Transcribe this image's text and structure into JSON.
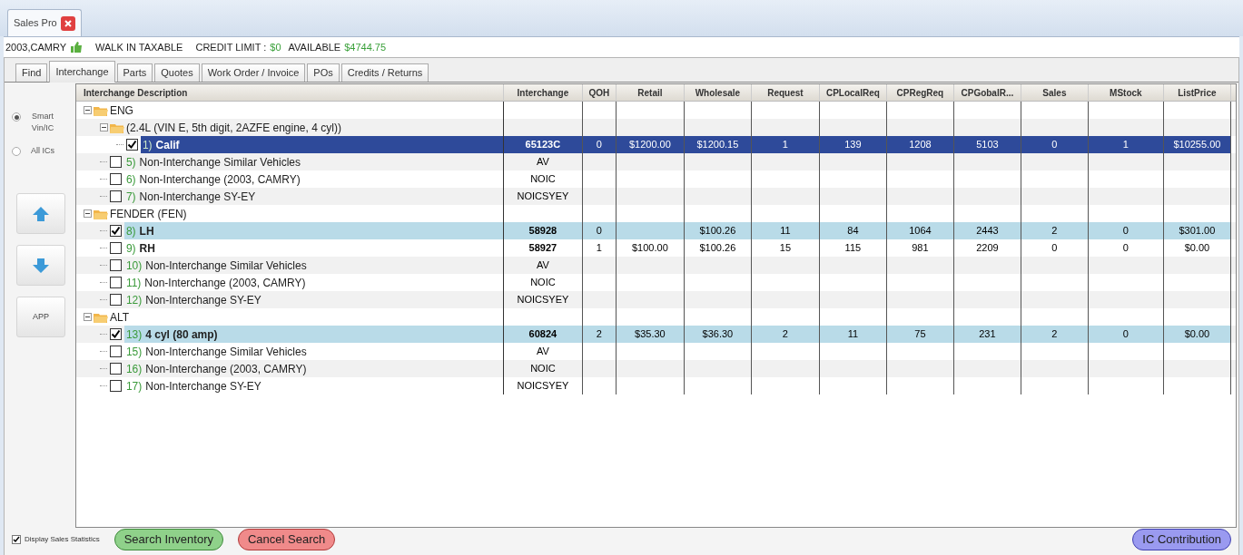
{
  "window_tab": {
    "title": "Sales Pro"
  },
  "info_bar": {
    "vehicle": "2003,CAMRY",
    "customer": "WALK IN TAXABLE",
    "credit_label": "CREDIT LIMIT :",
    "credit_value": "$0",
    "available_label": "AVAILABLE",
    "available_value": "$4744.75"
  },
  "tabs": [
    {
      "label": "Find",
      "selected": false
    },
    {
      "label": "Interchange",
      "selected": true
    },
    {
      "label": "Parts",
      "selected": false
    },
    {
      "label": "Quotes",
      "selected": false
    },
    {
      "label": "Work Order / Invoice",
      "selected": false
    },
    {
      "label": "POs",
      "selected": false
    },
    {
      "label": "Credits / Returns",
      "selected": false
    }
  ],
  "search_mode": [
    {
      "label": "Smart Vin/IC",
      "selected": true
    },
    {
      "label": "All ICs",
      "selected": false
    }
  ],
  "side_buttons": [
    {
      "kind": "up"
    },
    {
      "kind": "down"
    },
    {
      "kind": "text",
      "label": "APP"
    }
  ],
  "table": {
    "columns": [
      "Interchange Description",
      "Interchange",
      "QOH",
      "Retail",
      "Wholesale",
      "Request",
      "CPLocalReq",
      "CPRegReq",
      "CPGobalR...",
      "Sales",
      "MStock",
      "ListPrice"
    ],
    "tree": [
      {
        "kind": "group",
        "label": "ENG",
        "expanded": true,
        "children": [
          {
            "kind": "group",
            "label": "(2.4L (VIN E, 5th digit, 2AZFE engine, 4 cyl))",
            "expanded": true,
            "children": [
              {
                "kind": "part",
                "number": "1)",
                "label": "Calif",
                "checked": true,
                "selected": true,
                "cells": [
                  "65123C",
                  "0",
                  "$1200.00",
                  "$1200.15",
                  "1",
                  "139",
                  "1208",
                  "5103",
                  "0",
                  "1",
                  "$10255.00"
                ]
              }
            ]
          },
          {
            "kind": "other",
            "number": "5)",
            "label": "Non-Interchange Similar Vehicles",
            "checked": false,
            "selected": false,
            "cells": [
              "AV"
            ]
          },
          {
            "kind": "other",
            "number": "6)",
            "label": "Non-Interchange (2003, CAMRY)",
            "checked": false,
            "selected": false,
            "cells": [
              "NOIC"
            ]
          },
          {
            "kind": "other",
            "number": "7)",
            "label": "Non-Interchange SY-EY",
            "checked": false,
            "selected": false,
            "cells": [
              "NOICSYEY"
            ]
          }
        ]
      },
      {
        "kind": "group",
        "label": "FENDER (FEN)",
        "expanded": true,
        "children": [
          {
            "kind": "part",
            "number": "8)",
            "label": "LH",
            "checked": true,
            "selected": false,
            "cells": [
              "58928",
              "0",
              "",
              "$100.26",
              "11",
              "84",
              "1064",
              "2443",
              "2",
              "0",
              "$301.00"
            ]
          },
          {
            "kind": "part",
            "number": "9)",
            "label": "RH",
            "checked": false,
            "selected": false,
            "cells": [
              "58927",
              "1",
              "$100.00",
              "$100.26",
              "15",
              "115",
              "981",
              "2209",
              "0",
              "0",
              "$0.00"
            ]
          },
          {
            "kind": "other",
            "number": "10)",
            "label": "Non-Interchange Similar Vehicles",
            "checked": false,
            "selected": false,
            "cells": [
              "AV"
            ]
          },
          {
            "kind": "other",
            "number": "11)",
            "label": "Non-Interchange (2003, CAMRY)",
            "checked": false,
            "selected": false,
            "cells": [
              "NOIC"
            ]
          },
          {
            "kind": "other",
            "number": "12)",
            "label": "Non-Interchange SY-EY",
            "checked": false,
            "selected": false,
            "cells": [
              "NOICSYEY"
            ]
          }
        ]
      },
      {
        "kind": "group",
        "label": "ALT",
        "expanded": true,
        "children": [
          {
            "kind": "part",
            "number": "13)",
            "label": "4 cyl (80 amp)",
            "checked": true,
            "selected": false,
            "cells": [
              "60824",
              "2",
              "$35.30",
              "$36.30",
              "2",
              "11",
              "75",
              "231",
              "2",
              "0",
              "$0.00"
            ]
          },
          {
            "kind": "other",
            "number": "15)",
            "label": "Non-Interchange Similar Vehicles",
            "checked": false,
            "selected": false,
            "cells": [
              "AV"
            ]
          },
          {
            "kind": "other",
            "number": "16)",
            "label": "Non-Interchange (2003, CAMRY)",
            "checked": false,
            "selected": false,
            "cells": [
              "NOIC"
            ]
          },
          {
            "kind": "other",
            "number": "17)",
            "label": "Non-Interchange SY-EY",
            "checked": false,
            "selected": false,
            "cells": [
              "NOICSYEY"
            ]
          }
        ]
      }
    ]
  },
  "footer": {
    "statistics": {
      "label": "Display Sales Statistics",
      "checked": true
    },
    "buttons": [
      {
        "kind": "green",
        "label": "Search Inventory"
      },
      {
        "kind": "red",
        "label": "Cancel Search"
      },
      {
        "kind": "blue",
        "label": "IC Contribution"
      }
    ]
  }
}
